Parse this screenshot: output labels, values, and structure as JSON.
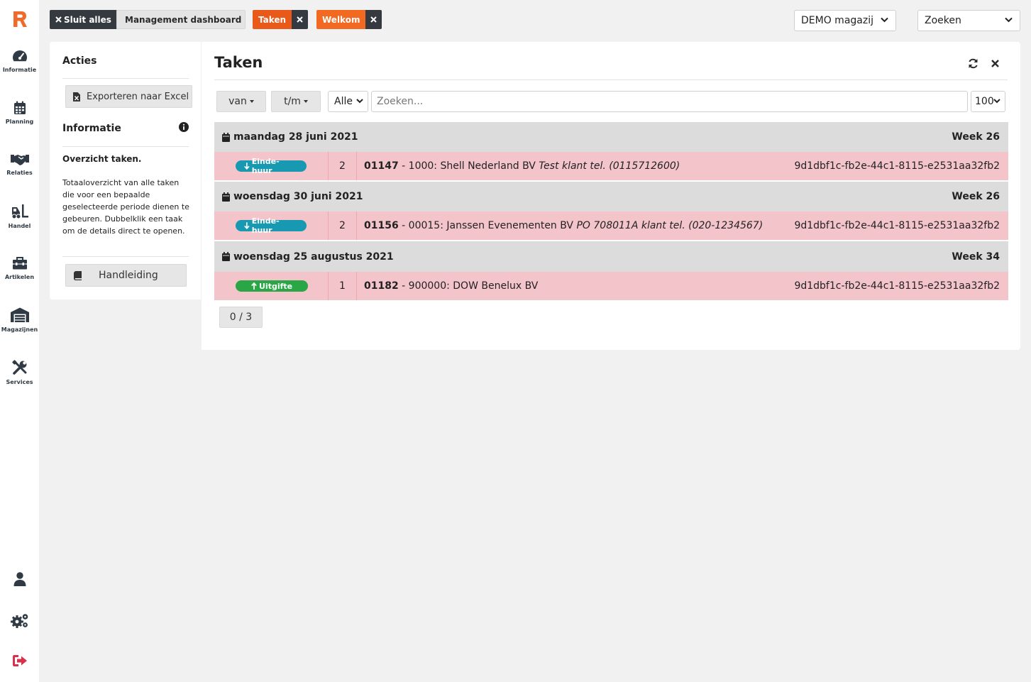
{
  "sidebar": {
    "items": [
      {
        "label": "Informatie",
        "icon": "gauge-icon"
      },
      {
        "label": "Planning",
        "icon": "calendar-icon"
      },
      {
        "label": "Relaties",
        "icon": "handshake-icon"
      },
      {
        "label": "Handel",
        "icon": "forklift-icon"
      },
      {
        "label": "Artikelen",
        "icon": "toolbox-icon"
      },
      {
        "label": "Magazijnen",
        "icon": "warehouse-icon"
      },
      {
        "label": "Services",
        "icon": "tools-icon"
      }
    ],
    "bottom_icons": [
      "user-icon",
      "settings-icon",
      "logout-icon"
    ],
    "brand_color": "#ef6a2b"
  },
  "topbar": {
    "close_all": "Sluit alles",
    "dashboard": "Management dashboard",
    "tabs": [
      {
        "label": "Taken"
      },
      {
        "label": "Welkom"
      }
    ],
    "warehouse_select": "DEMO magazij",
    "search_select": "Zoeken"
  },
  "left_panel": {
    "actions_heading": "Acties",
    "export_button": "Exporteren naar Excel",
    "info_heading": "Informatie",
    "info_title": "Overzicht taken.",
    "info_text": "Totaaloverzicht van alle taken die voor een bepaalde geselecteerde periode dienen te gebeuren. Dubbelklik een taak om de details direct te openen.",
    "manual_button": "Handleiding"
  },
  "main": {
    "title": "Taken",
    "filters": {
      "from_label": "van",
      "to_label": "t/m",
      "type_select": "Alle",
      "search_placeholder": "Zoeken...",
      "page_size": "100"
    },
    "groups": [
      {
        "date": "maandag 28 juni 2021",
        "week": "Week 26",
        "tasks": [
          {
            "badge": "Einde-huur",
            "badge_type": "return",
            "qty": "2",
            "number": "01147",
            "customer": " - 1000: Shell Nederland BV ",
            "note": "Test klant tel. (0115712600)",
            "uuid": "9d1dbf1c-fb2e-44c1-8115-e2531aa32fb2"
          }
        ]
      },
      {
        "date": "woensdag 30 juni 2021",
        "week": "Week 26",
        "tasks": [
          {
            "badge": "Einde-huur",
            "badge_type": "return",
            "qty": "2",
            "number": "01156",
            "customer": " - 00015: Janssen Evenementen BV ",
            "note": "PO 708011A klant tel. (020-1234567)",
            "uuid": "9d1dbf1c-fb2e-44c1-8115-e2531aa32fb2"
          }
        ]
      },
      {
        "date": "woensdag 25 augustus 2021",
        "week": "Week 34",
        "tasks": [
          {
            "badge": "Uitgifte",
            "badge_type": "issue",
            "qty": "1",
            "number": "01182",
            "customer": " - 900000: DOW Benelux BV",
            "note": "",
            "uuid": "9d1dbf1c-fb2e-44c1-8115-e2531aa32fb2"
          }
        ]
      }
    ],
    "pager": "0 / 3"
  }
}
